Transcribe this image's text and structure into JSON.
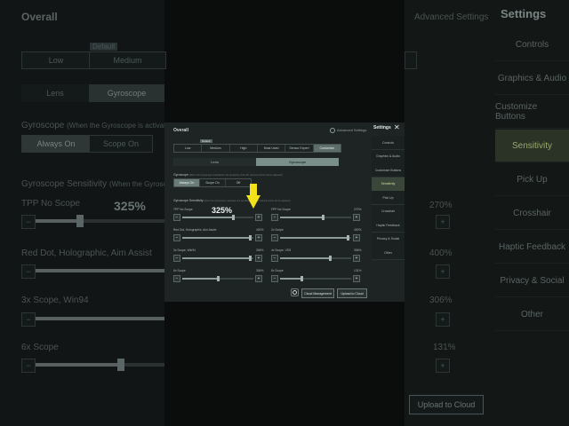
{
  "background": {
    "overall": "Overall",
    "advanced": "Advanced Settings",
    "settings": "Settings",
    "default_tag": "Default",
    "preset_low": "Low",
    "preset_medium": "Medium",
    "tab_lens": "Lens",
    "tab_gyroscope": "Gyroscope",
    "gyro_label": "Gyroscope",
    "gyro_note": "(When the Gyroscope is activated...",
    "always_on": "Always On",
    "scope_on": "Scope On",
    "gyro_sens": "Gyroscope Sensitivity",
    "gyro_sens_note": "(When the Gyroscope",
    "tpp": "TPP No Scope",
    "tpp_val": "325%",
    "tpp_right_val": "270%",
    "red_dot": "Red Dot, Holographic, Aim Assist",
    "red_dot_right_val": "400%",
    "x3": "3x Scope, Win94",
    "x3_right_val": "306%",
    "x6": "6x Scope",
    "x6_right_val": "131%",
    "upload": "Upload to Cloud",
    "side_items": [
      "Controls",
      "Graphics & Audio",
      "Customize Buttons",
      "Sensitivity",
      "Pick Up",
      "Crosshair",
      "Haptic Feedback",
      "Privacy & Social",
      "Other"
    ]
  },
  "panel": {
    "title": "Overall",
    "advanced": "Advanced Settings",
    "default_tag": "Default",
    "presets": [
      "Low",
      "Medium",
      "High",
      "Most Used",
      "Sensor Expert",
      "Customize"
    ],
    "tabs": [
      "Lens",
      "Gyroscope"
    ],
    "gyro_label": "Gyroscope",
    "gyro_note": "(When the Gyroscope is activated, the sensitivity of the FK camera control can be adjusted)",
    "gyro_options": [
      "Always On",
      "Scope On",
      "Off"
    ],
    "sens_label": "Gyroscope Sensitivity",
    "sens_note": "(When the Gyroscope is activated, the sensitivity of the FK camera control can be adjusted)",
    "big_value": "325%",
    "sliders": [
      {
        "label": "TPP No Scope",
        "value": "",
        "level": 0.72
      },
      {
        "label": "FPP No Scope",
        "value": "270%",
        "level": 0.6
      },
      {
        "label": "Red Dot, Holographic, Aim Assist",
        "value": "400%",
        "level": 0.95
      },
      {
        "label": "2x Scope",
        "value": "400%",
        "level": 0.95
      },
      {
        "label": "3x Scope, Win94",
        "value": "306%",
        "level": 0.95
      },
      {
        "label": "4x Scope, VSS",
        "value": "306%",
        "level": 0.7
      },
      {
        "label": "6x Scope",
        "value": "306%",
        "level": 0.5
      },
      {
        "label": "8x Scope",
        "value": "131%",
        "level": 0.3
      }
    ],
    "cloud_mgmt": "Cloud Management",
    "upload": "Upload to Cloud",
    "settings": "Settings",
    "side_items": [
      "Controls",
      "Graphics & Audio",
      "Customize Buttons",
      "Sensitivity",
      "Pick Up",
      "Crosshair",
      "Haptic Feedback",
      "Privacy & Social",
      "Other"
    ],
    "active_side": "Sensitivity"
  },
  "colors": {
    "accent_active": "#d3de97",
    "arrow": "#f3e21a"
  }
}
